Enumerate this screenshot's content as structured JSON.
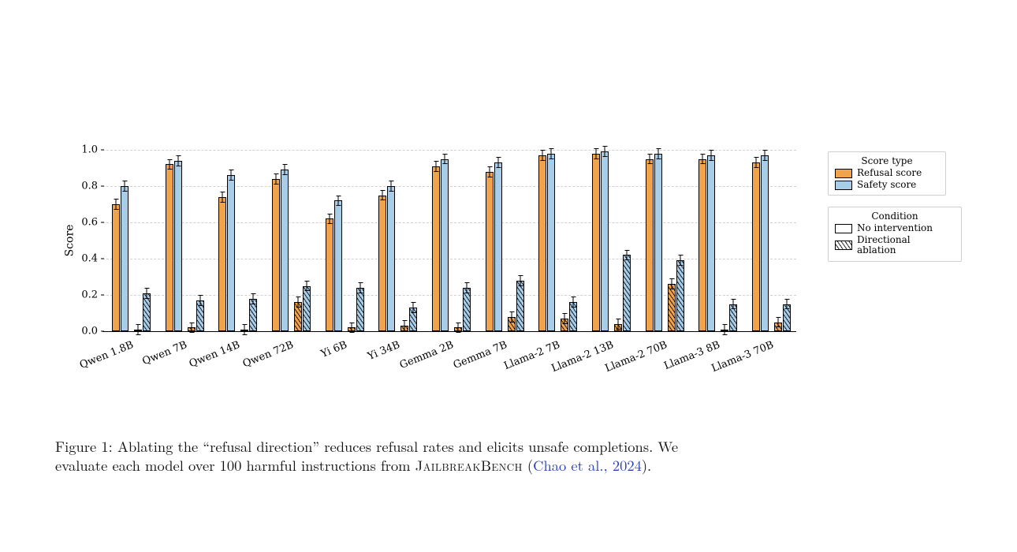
{
  "chart_data": {
    "type": "bar",
    "ylabel": "Score",
    "ylim": [
      0,
      1.0
    ],
    "yticks": [
      0.0,
      0.2,
      0.4,
      0.6,
      0.8,
      1.0
    ],
    "categories": [
      "Qwen 1.8B",
      "Qwen 7B",
      "Qwen 14B",
      "Qwen 72B",
      "Yi 6B",
      "Yi 34B",
      "Gemma 2B",
      "Gemma 7B",
      "Llama-2 7B",
      "Llama-2 13B",
      "Llama-2 70B",
      "Llama-3 8B",
      "Llama-3 70B"
    ],
    "series": [
      {
        "name": "Refusal score — No intervention",
        "score_type": "Refusal score",
        "condition": "No intervention",
        "hatch": false,
        "color": "#f0a34a",
        "values": [
          0.7,
          0.92,
          0.74,
          0.84,
          0.62,
          0.75,
          0.91,
          0.88,
          0.97,
          0.98,
          0.95,
          0.95,
          0.93
        ]
      },
      {
        "name": "Safety score — No intervention",
        "score_type": "Safety score",
        "condition": "No intervention",
        "hatch": false,
        "color": "#a7cde8",
        "values": [
          0.8,
          0.94,
          0.86,
          0.89,
          0.72,
          0.8,
          0.95,
          0.93,
          0.98,
          0.99,
          0.98,
          0.97,
          0.97
        ]
      },
      {
        "name": "Refusal score — Directional ablation",
        "score_type": "Refusal score",
        "condition": "Directional ablation",
        "hatch": true,
        "color": "#f0a34a",
        "values": [
          0.01,
          0.02,
          0.01,
          0.16,
          0.02,
          0.03,
          0.02,
          0.08,
          0.07,
          0.04,
          0.26,
          0.01,
          0.05
        ]
      },
      {
        "name": "Safety score — Directional ablation",
        "score_type": "Safety score",
        "condition": "Directional ablation",
        "hatch": true,
        "color": "#a7cde8",
        "values": [
          0.21,
          0.17,
          0.18,
          0.25,
          0.24,
          0.13,
          0.24,
          0.28,
          0.16,
          0.42,
          0.39,
          0.15,
          0.15
        ]
      }
    ],
    "error": 0.03,
    "legend_score_type": {
      "title": "Score type",
      "items": [
        {
          "label": "Refusal score",
          "class": "refusal"
        },
        {
          "label": "Safety score",
          "class": "safety"
        }
      ]
    },
    "legend_condition": {
      "title": "Condition",
      "items": [
        {
          "label": "No intervention",
          "hatch": false
        },
        {
          "label": "Directional\nablation",
          "hatch": true
        }
      ]
    }
  },
  "caption": {
    "fig_label": "Figure 1:",
    "line1_rest": " Ablating the “refusal direction” reduces refusal rates and elicits unsafe completions. We",
    "line2_a": "evaluate each model over 100 harmful instructions from ",
    "bench_name": "JailbreakBench",
    "line2_b": " (",
    "citation": "Chao et al., 2024",
    "line2_c": ")."
  }
}
